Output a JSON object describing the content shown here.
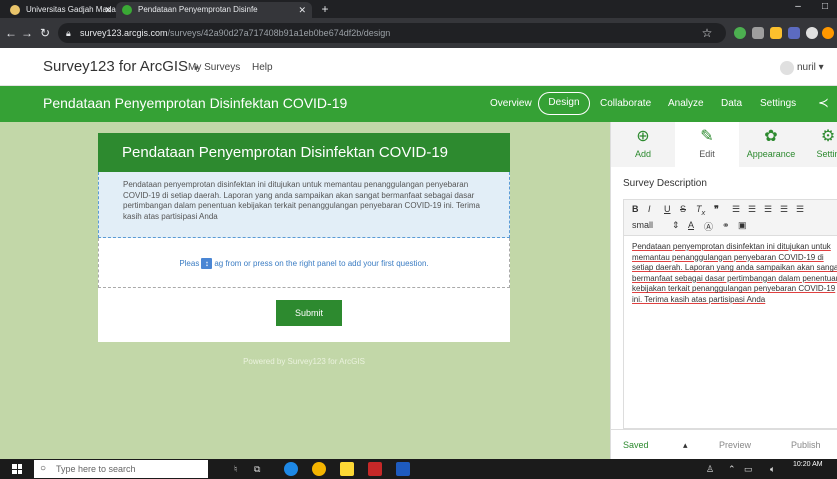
{
  "browser": {
    "tabs": [
      {
        "title": "Universitas Gadjah Mada",
        "favicon_color": "#e9c46a"
      },
      {
        "title": "Pendataan Penyemprotan Disinfe",
        "favicon_color": "#3aa935"
      }
    ],
    "new_tab": "+",
    "url_host": "survey123.arcgis.com",
    "url_path": "/surveys/42a90d27a717408b91a1eb0be674df2b/design",
    "win_min": "–",
    "win_max": "□"
  },
  "app": {
    "name": "Survey123 for ArcGIS",
    "nav": [
      "My Surveys",
      "Help"
    ],
    "user": "nuril"
  },
  "survey_bar": {
    "title": "Pendataan Penyemprotan Disinfektan COVID-19",
    "tabs": [
      "Overview",
      "Design",
      "Collaborate",
      "Analyze",
      "Data",
      "Settings"
    ],
    "active_tab": "Design",
    "accent_color": "#35a135"
  },
  "form": {
    "title": "Pendataan Penyemprotan Disinfektan COVID-19",
    "description": "Pendataan penyemprotan disinfektan ini ditujukan untuk memantau penanggulangan penyebaran COVID-19 di setiap daerah. Laporan yang anda sampaikan akan sangat bermanfaat sebagai dasar pertimbangan dalam penentuan kebijakan terkait penanggulangan penyebaran COVID-19 ini. Terima kasih atas partisipasi Anda",
    "hint_before": "Pleas",
    "hint_after": "ag from or press on the right panel to add your first question.",
    "submit_label": "Submit",
    "powered_by": "Powered by Survey123 for ArcGIS"
  },
  "panel": {
    "tabs": [
      {
        "label": "Add",
        "icon": "plus-circle-icon"
      },
      {
        "label": "Edit",
        "icon": "pencil-icon"
      },
      {
        "label": "Appearance",
        "icon": "palette-icon"
      },
      {
        "label": "Settin",
        "icon": "settings-icon"
      }
    ],
    "section_title": "Survey Description",
    "font_size": "small",
    "description": "Pendataan penyemprotan disinfektan ini ditujukan untuk memantau penanggulangan penyebaran COVID-19 di setiap daerah. Laporan yang anda sampaikan akan sangat bermanfaat sebagai dasar pertimbangan dalam penentuan kebijakan terkait penanggulangan penyebaran COVID-19 ini. Terima kasih atas partisipasi Anda",
    "footer": {
      "saved": "Saved",
      "preview": "Preview",
      "publish": "Publish"
    }
  },
  "taskbar": {
    "search_placeholder": "Type here to search",
    "time": "10:20 AM"
  }
}
